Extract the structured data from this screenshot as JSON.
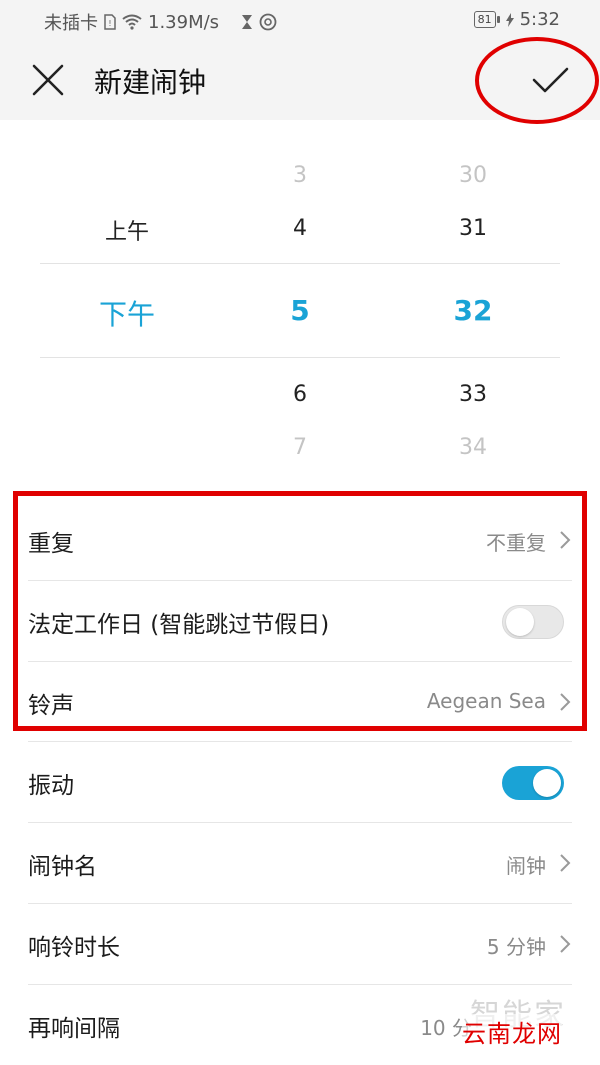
{
  "status_bar": {
    "carrier": "未插卡",
    "speed": "1.39M/s",
    "battery": "81",
    "time": "5:32"
  },
  "header": {
    "title": "新建闹钟",
    "close_icon": "close-icon",
    "confirm_icon": "check-icon"
  },
  "time_picker": {
    "ampm": {
      "above": "上午",
      "selected": "下午"
    },
    "hours": {
      "far_above": "3",
      "above": "4",
      "selected": "5",
      "below": "6",
      "far_below": "7"
    },
    "minutes": {
      "far_above": "30",
      "above": "31",
      "selected": "32",
      "below": "33",
      "far_below": "34"
    },
    "accent_color": "#1aa3d6"
  },
  "settings": {
    "repeat": {
      "label": "重复",
      "value": "不重复"
    },
    "workday": {
      "label": "法定工作日 (智能跳过节假日)",
      "enabled": false
    },
    "ringtone": {
      "label": "铃声",
      "value": "Aegean Sea"
    },
    "vibrate": {
      "label": "振动",
      "enabled": true
    },
    "name": {
      "label": "闹钟名",
      "value": "闹钟"
    },
    "duration": {
      "label": "响铃时长",
      "value": "5 分钟"
    },
    "snooze": {
      "label": "再响间隔",
      "value": "10 分"
    }
  },
  "watermarks": {
    "top": "智能家",
    "bottom": "云南龙网"
  }
}
